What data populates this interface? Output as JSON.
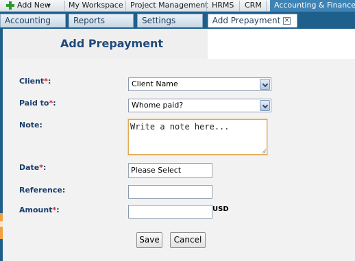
{
  "topbar": {
    "add_new": "Add New",
    "items": [
      "My Workspace",
      "Project Management",
      "HRMS",
      "CRM"
    ],
    "active": "Accounting & Finance"
  },
  "tabs": {
    "items": [
      "Accounting",
      "Reports",
      "Settings"
    ],
    "active": "Add Prepayment"
  },
  "page": {
    "title": "Add Prepayment"
  },
  "form": {
    "required_mark": "*",
    "client": {
      "label": "Client",
      "value": "Client Name"
    },
    "paid_to": {
      "label": "Paid to",
      "value": "Whome paid?"
    },
    "note": {
      "label": "Note:",
      "value": "Write a note here..."
    },
    "date": {
      "label": "Date",
      "value": "Please Select"
    },
    "reference": {
      "label": "Reference:",
      "value": ""
    },
    "amount": {
      "label": "Amount",
      "value": "",
      "currency": "USD"
    },
    "save_label": "Save",
    "cancel_label": "Cancel"
  },
  "colors": {
    "brand_blue": "#1e5f8c",
    "active_tab": "#3d83b5",
    "required": "#dd2222",
    "label": "#1a3d6b"
  }
}
